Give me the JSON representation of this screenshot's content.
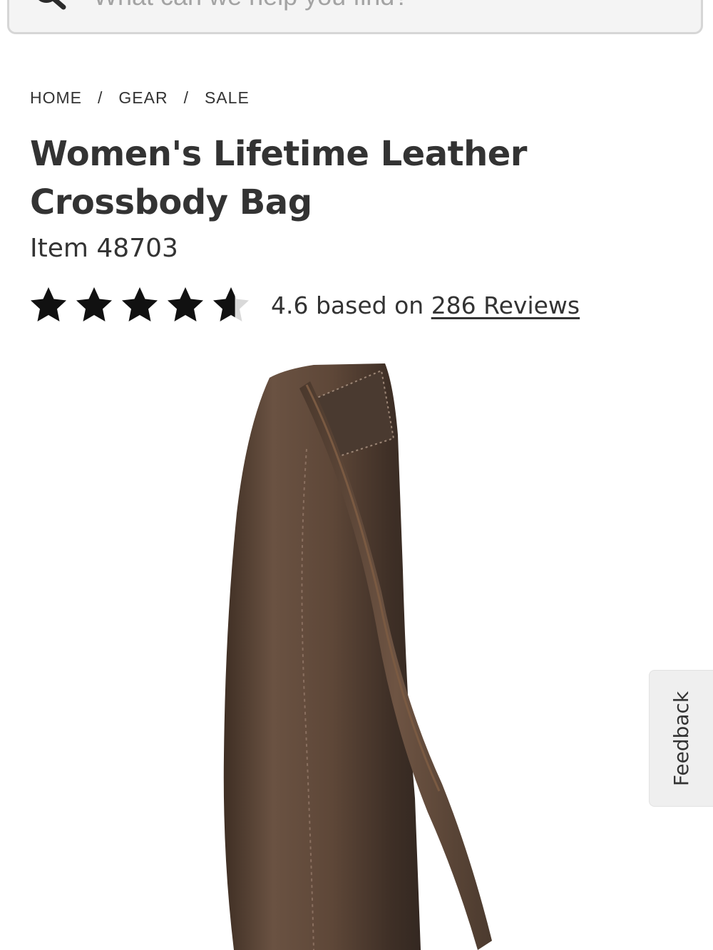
{
  "search": {
    "placeholder": "What can we help you find?"
  },
  "breadcrumb": {
    "items": [
      "HOME",
      "GEAR",
      "SALE"
    ],
    "separator": "/"
  },
  "product": {
    "title": "Women's Lifetime Leather Crossbody Bag",
    "item_number": "Item 48703",
    "rating": {
      "value": 4.6,
      "max": 5,
      "text_prefix": "4.6 based on",
      "reviews_link": "286 Reviews"
    },
    "image_icon": "leather-crossbody-bag",
    "leather_color": "#5b4536"
  },
  "feedback": {
    "label": "Feedback"
  },
  "colors": {
    "text": "#333333",
    "search_bg": "#f4f4f4",
    "search_border": "#d6d6d6",
    "star_filled": "#111111",
    "star_empty": "#d9d9d9"
  }
}
